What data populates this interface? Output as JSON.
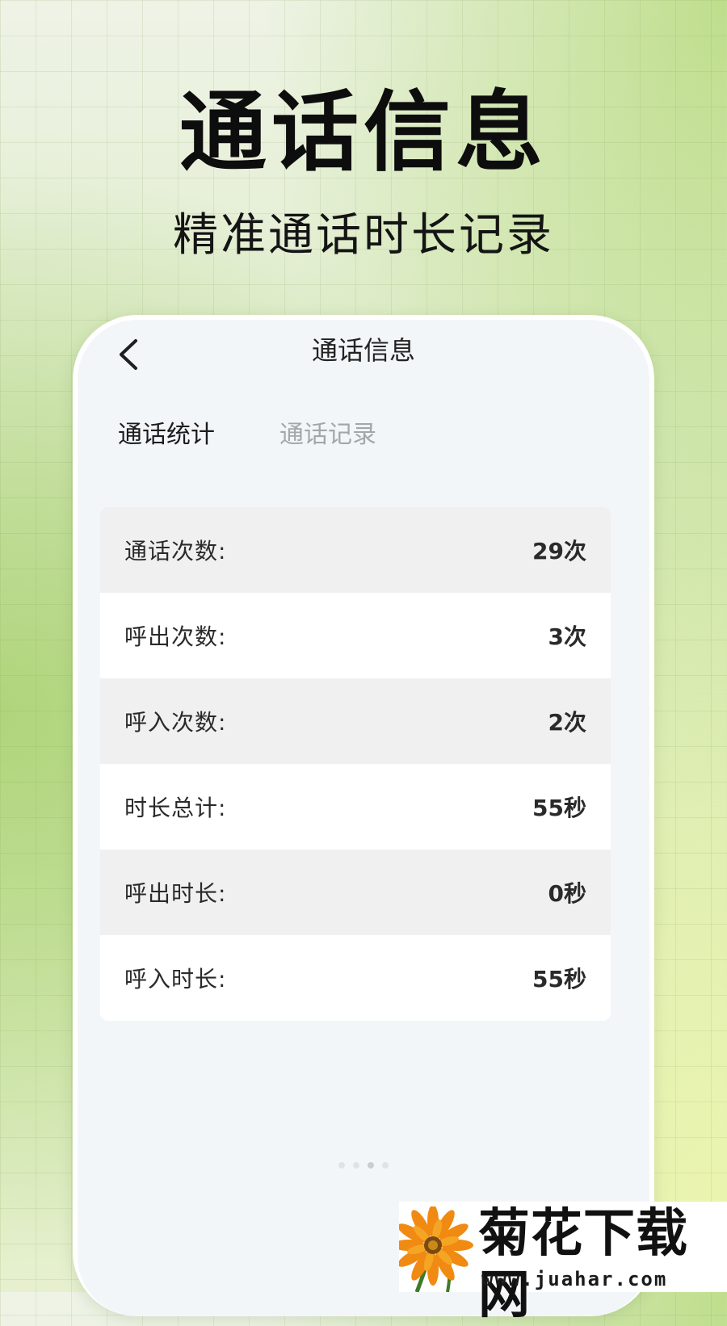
{
  "promo": {
    "title": "通话信息",
    "subtitle": "精准通话时长记录"
  },
  "screen": {
    "title": "通话信息",
    "back_icon": "chevron-left-icon",
    "tabs": [
      {
        "label": "通话统计",
        "active": true
      },
      {
        "label": "通话记录",
        "active": false
      }
    ],
    "stats": [
      {
        "label": "通话次数:",
        "value": "29次"
      },
      {
        "label": "呼出次数:",
        "value": "3次"
      },
      {
        "label": "呼入次数:",
        "value": "2次"
      },
      {
        "label": "时长总计:",
        "value": "55秒"
      },
      {
        "label": "呼出时长:",
        "value": "0秒"
      },
      {
        "label": "呼入时长:",
        "value": "55秒"
      }
    ]
  },
  "watermark": {
    "brand": "菊花下载网",
    "url": "www.juahar.com"
  },
  "colors": {
    "tab_active": "#1c1c1c",
    "tab_inactive": "#a3a7ac",
    "row_alt": "#f0f0f0",
    "row": "#ffffff"
  }
}
